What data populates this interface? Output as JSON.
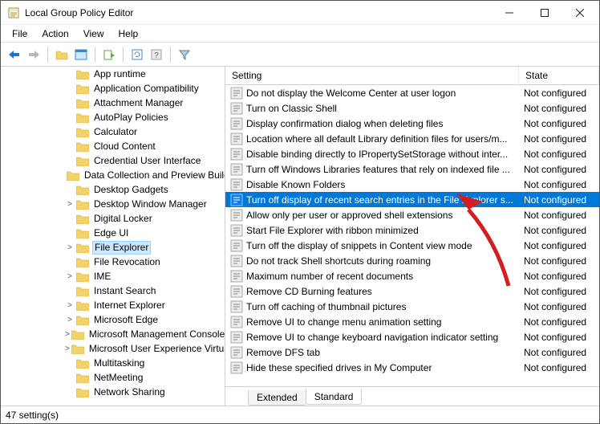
{
  "window": {
    "title": "Local Group Policy Editor"
  },
  "menu": {
    "items": [
      "File",
      "Action",
      "View",
      "Help"
    ]
  },
  "tree": {
    "items": [
      {
        "label": "App runtime",
        "depth": 4,
        "twisty": ""
      },
      {
        "label": "Application Compatibility",
        "depth": 4,
        "twisty": ""
      },
      {
        "label": "Attachment Manager",
        "depth": 4,
        "twisty": ""
      },
      {
        "label": "AutoPlay Policies",
        "depth": 4,
        "twisty": ""
      },
      {
        "label": "Calculator",
        "depth": 4,
        "twisty": ""
      },
      {
        "label": "Cloud Content",
        "depth": 4,
        "twisty": ""
      },
      {
        "label": "Credential User Interface",
        "depth": 4,
        "twisty": ""
      },
      {
        "label": "Data Collection and Preview Builds",
        "depth": 4,
        "twisty": ""
      },
      {
        "label": "Desktop Gadgets",
        "depth": 4,
        "twisty": ""
      },
      {
        "label": "Desktop Window Manager",
        "depth": 4,
        "twisty": ">"
      },
      {
        "label": "Digital Locker",
        "depth": 4,
        "twisty": ""
      },
      {
        "label": "Edge UI",
        "depth": 4,
        "twisty": ""
      },
      {
        "label": "File Explorer",
        "depth": 4,
        "twisty": ">",
        "hl": true
      },
      {
        "label": "File Revocation",
        "depth": 4,
        "twisty": ""
      },
      {
        "label": "IME",
        "depth": 4,
        "twisty": ">"
      },
      {
        "label": "Instant Search",
        "depth": 4,
        "twisty": ""
      },
      {
        "label": "Internet Explorer",
        "depth": 4,
        "twisty": ">"
      },
      {
        "label": "Microsoft Edge",
        "depth": 4,
        "twisty": ">"
      },
      {
        "label": "Microsoft Management Console",
        "depth": 4,
        "twisty": ">"
      },
      {
        "label": "Microsoft User Experience Virtualization",
        "depth": 4,
        "twisty": ">"
      },
      {
        "label": "Multitasking",
        "depth": 4,
        "twisty": ""
      },
      {
        "label": "NetMeeting",
        "depth": 4,
        "twisty": ""
      },
      {
        "label": "Network Sharing",
        "depth": 4,
        "twisty": ""
      }
    ]
  },
  "list": {
    "headers": {
      "setting": "Setting",
      "state": "State"
    },
    "rows": [
      {
        "label": "Do not display the Welcome Center at user logon",
        "state": "Not configured"
      },
      {
        "label": "Turn on Classic Shell",
        "state": "Not configured"
      },
      {
        "label": "Display confirmation dialog when deleting files",
        "state": "Not configured"
      },
      {
        "label": "Location where all default Library definition files for users/m...",
        "state": "Not configured"
      },
      {
        "label": "Disable binding directly to IPropertySetStorage without inter...",
        "state": "Not configured"
      },
      {
        "label": "Turn off Windows Libraries features that rely on indexed file ...",
        "state": "Not configured"
      },
      {
        "label": "Disable Known Folders",
        "state": "Not configured"
      },
      {
        "label": "Turn off display of recent search entries in the File Explorer s...",
        "state": "Not configured",
        "sel": true
      },
      {
        "label": "Allow only per user or approved shell extensions",
        "state": "Not configured"
      },
      {
        "label": "Start File Explorer with ribbon minimized",
        "state": "Not configured"
      },
      {
        "label": "Turn off the display of snippets in Content view mode",
        "state": "Not configured"
      },
      {
        "label": "Do not track Shell shortcuts during roaming",
        "state": "Not configured"
      },
      {
        "label": "Maximum number of recent documents",
        "state": "Not configured"
      },
      {
        "label": "Remove CD Burning features",
        "state": "Not configured"
      },
      {
        "label": "Turn off caching of thumbnail pictures",
        "state": "Not configured"
      },
      {
        "label": "Remove UI to change menu animation setting",
        "state": "Not configured"
      },
      {
        "label": "Remove UI to change keyboard navigation indicator setting",
        "state": "Not configured"
      },
      {
        "label": "Remove DFS tab",
        "state": "Not configured"
      },
      {
        "label": "Hide these specified drives in My Computer",
        "state": "Not configured"
      }
    ]
  },
  "tabs": {
    "extended": "Extended",
    "standard": "Standard"
  },
  "status": {
    "text": "47 setting(s)"
  }
}
